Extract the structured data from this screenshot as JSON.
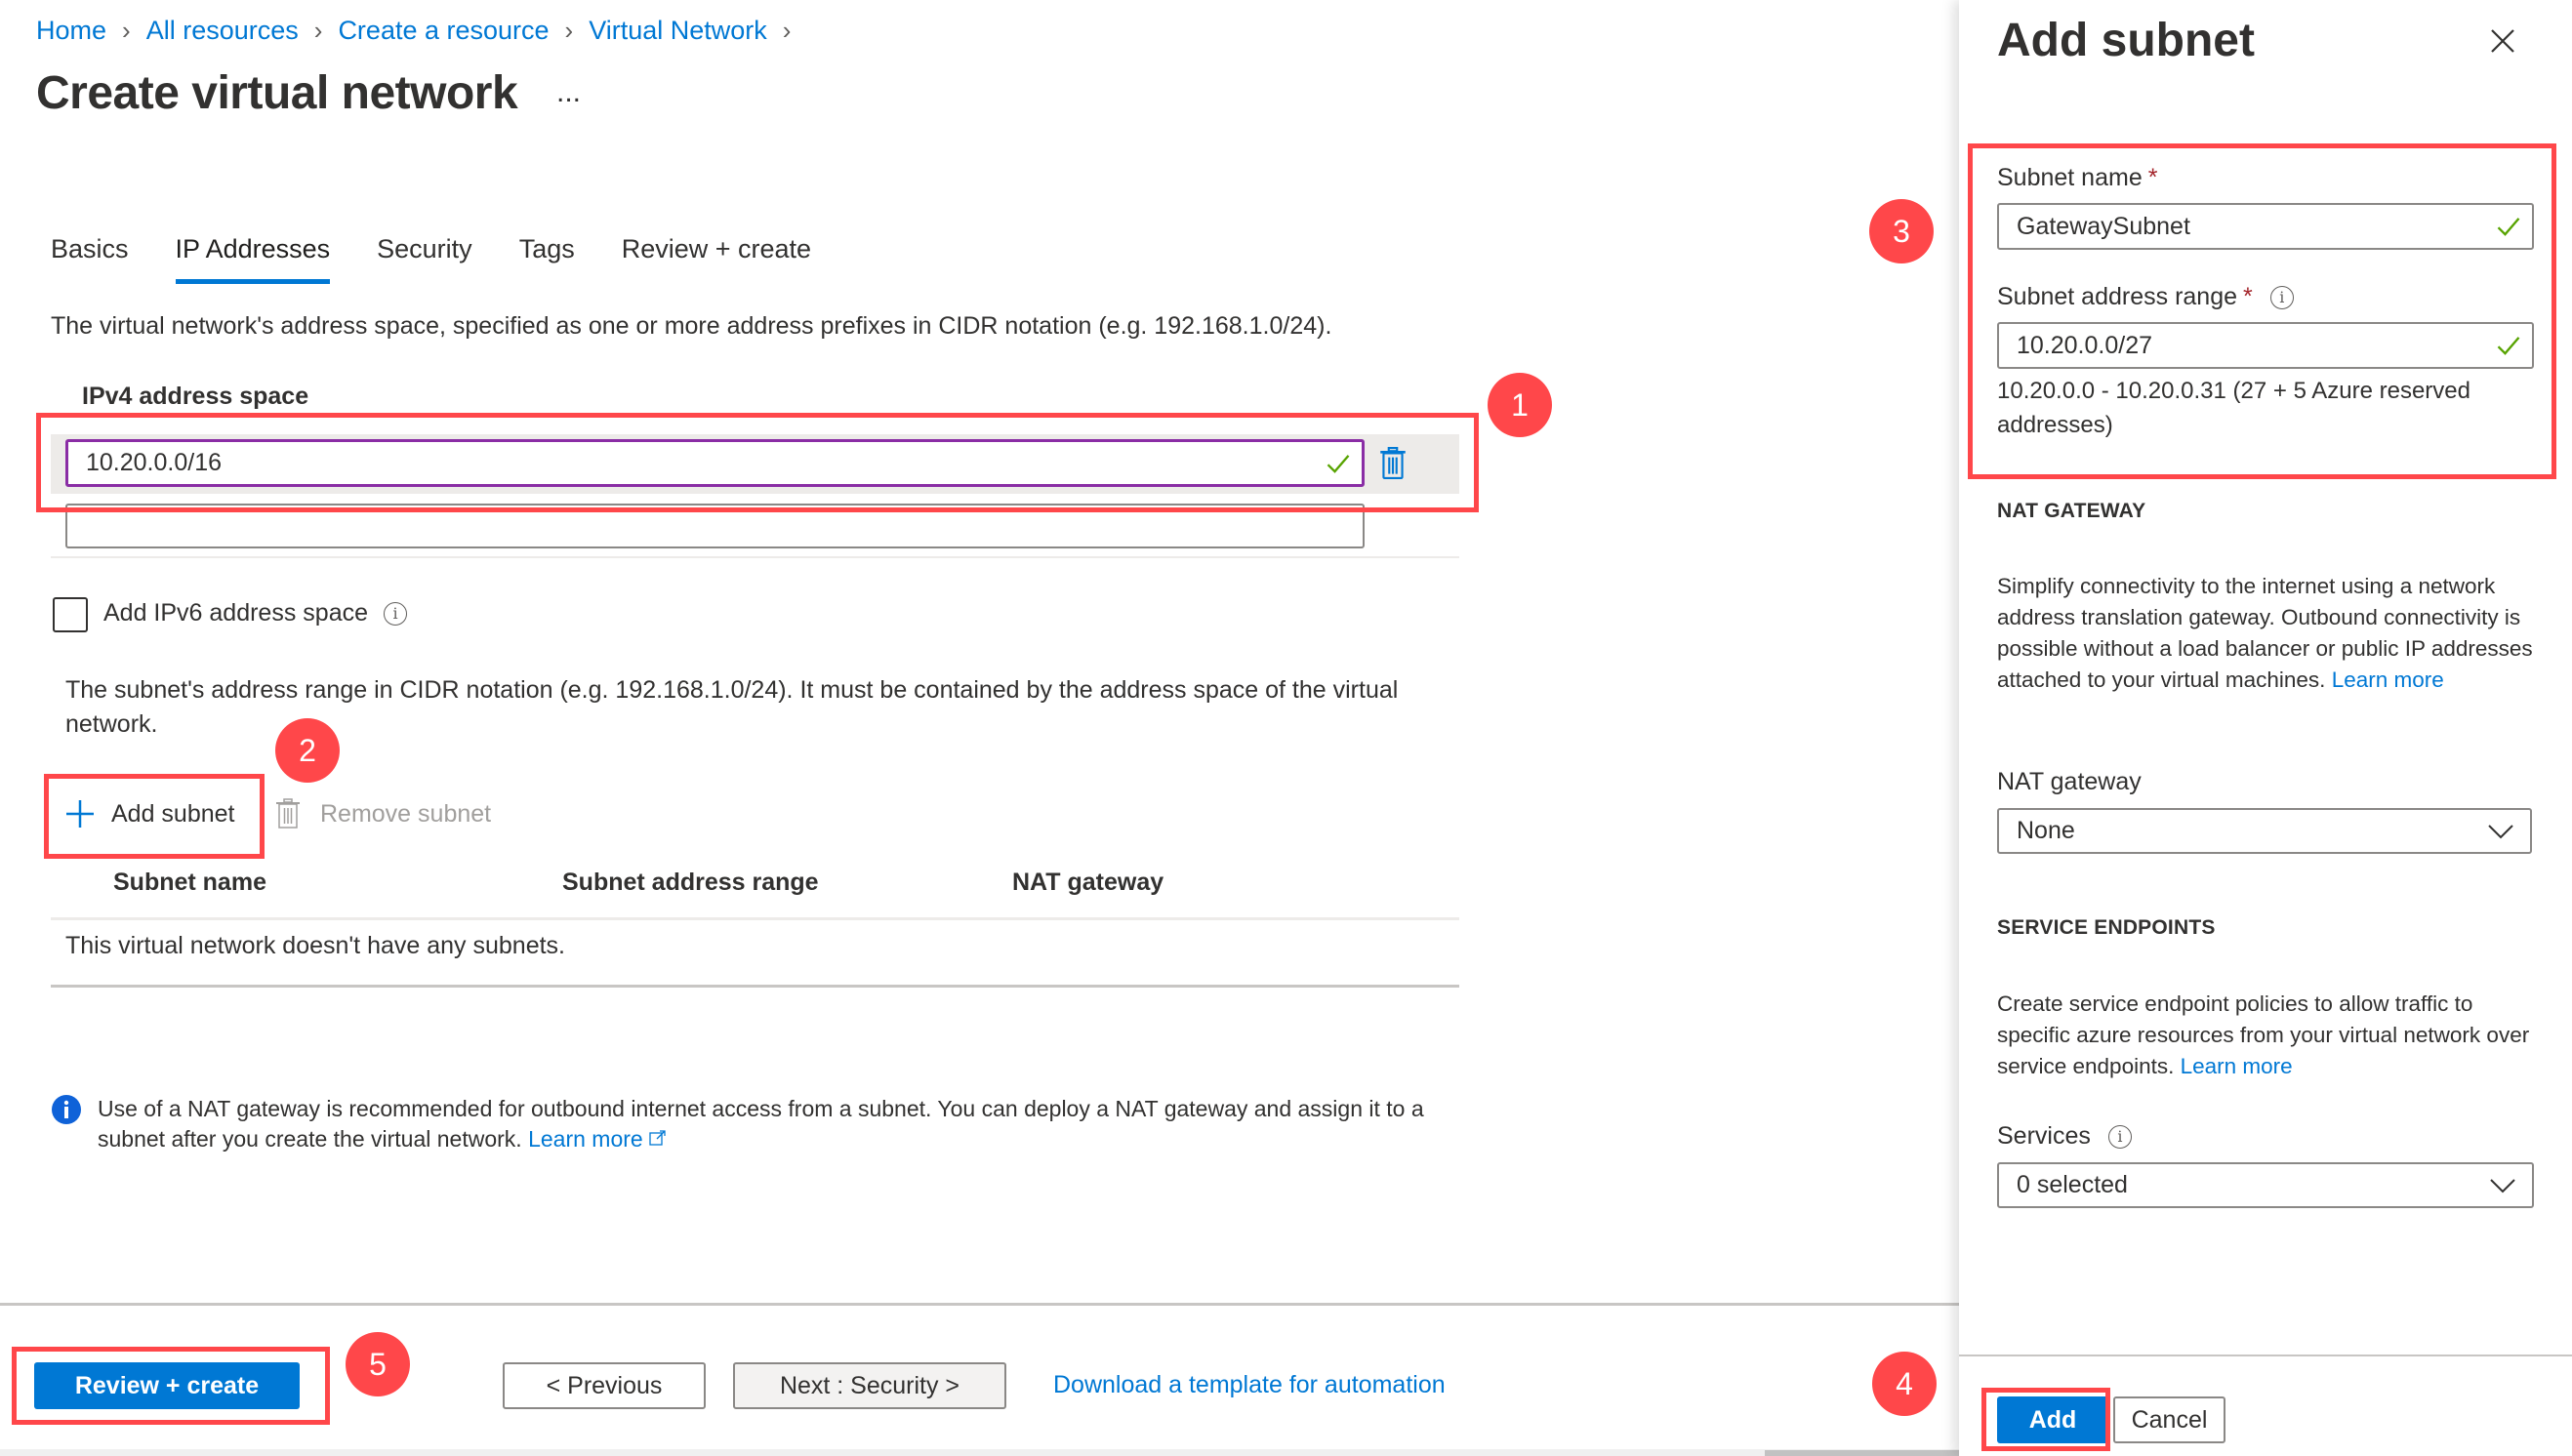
{
  "breadcrumb": [
    "Home",
    "All resources",
    "Create a resource",
    "Virtual Network"
  ],
  "page": {
    "title": "Create virtual network",
    "more_label": "..."
  },
  "tabs": [
    {
      "label": "Basics",
      "active": false
    },
    {
      "label": "IP Addresses",
      "active": true
    },
    {
      "label": "Security",
      "active": false
    },
    {
      "label": "Tags",
      "active": false
    },
    {
      "label": "Review + create",
      "active": false
    }
  ],
  "ip": {
    "description": "The virtual network's address space, specified as one or more address prefixes in CIDR notation (e.g. 192.168.1.0/24).",
    "ipv4_label": "IPv4 address space",
    "ipv4_value": "10.20.0.0/16",
    "ipv4_empty_value": "",
    "ipv6_checkbox_label": "Add IPv6 address space",
    "ipv6_checked": false,
    "subnet_description": "The subnet's address range in CIDR notation (e.g. 192.168.1.0/24). It must be contained by the address space of the virtual network.",
    "add_subnet_label": "Add subnet",
    "remove_subnet_label": "Remove subnet",
    "table_headers": [
      "Subnet name",
      "Subnet address range",
      "NAT gateway"
    ],
    "empty_message": "This virtual network doesn't have any subnets.",
    "nat_info": "Use of a NAT gateway is recommended for outbound internet access from a subnet. You can deploy a NAT gateway and assign it to a subnet after you create the virtual network.",
    "nat_info_link": "Learn more"
  },
  "footer": {
    "review_create": "Review + create",
    "previous": "< Previous",
    "next": "Next : Security >",
    "download_template": "Download a template for automation"
  },
  "panel": {
    "title": "Add subnet",
    "subnet_name_label": "Subnet name",
    "subnet_name_value": "GatewaySubnet",
    "subnet_range_label": "Subnet address range",
    "subnet_range_value": "10.20.0.0/27",
    "subnet_range_hint": "10.20.0.0 - 10.20.0.31 (27 + 5 Azure reserved addresses)",
    "required_marker": "*",
    "nat_section": "NAT GATEWAY",
    "nat_text": "Simplify connectivity to the internet using a network address translation gateway. Outbound connectivity is possible without a load balancer or public IP addresses attached to your virtual machines.",
    "nat_learn_more": "Learn more",
    "nat_gateway_label": "NAT gateway",
    "nat_gateway_value": "None",
    "service_section": "SERVICE ENDPOINTS",
    "service_text": "Create service endpoint policies to allow traffic to specific azure resources from your virtual network over service endpoints.",
    "service_learn_more": "Learn more",
    "services_label": "Services",
    "services_value": "0 selected",
    "add_button": "Add",
    "cancel_button": "Cancel"
  },
  "annotations": [
    "1",
    "2",
    "3",
    "4",
    "5"
  ],
  "colors": {
    "accent": "#0078d4",
    "annotation": "#ff474a",
    "valid_check": "#57a300",
    "focus_border": "#8a2da5"
  }
}
